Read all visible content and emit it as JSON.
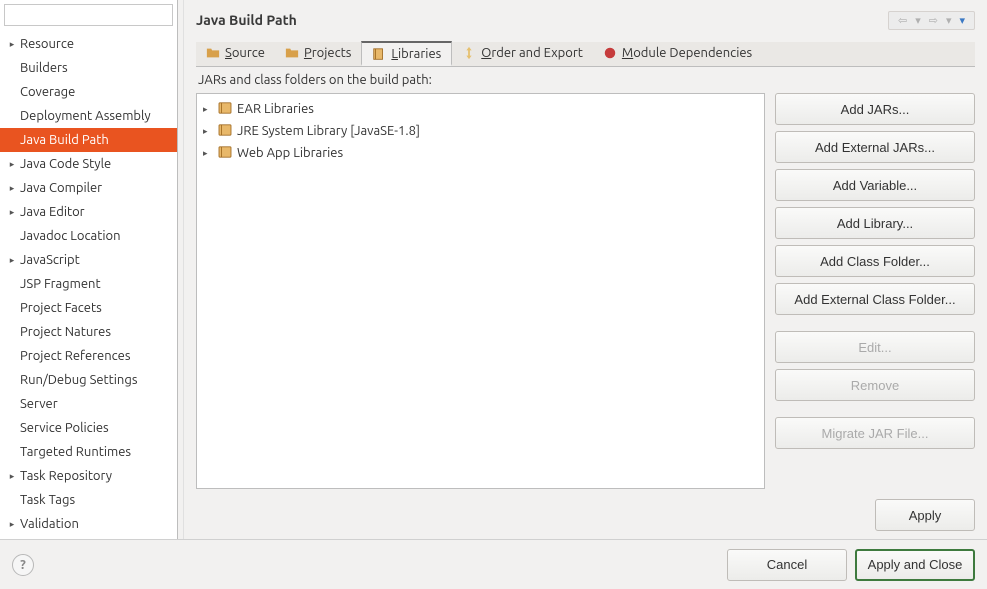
{
  "pageTitle": "Java Build Path",
  "filterPlaceholder": "",
  "sidebar": {
    "items": [
      {
        "label": "Resource",
        "expandable": true,
        "selected": false
      },
      {
        "label": "Builders",
        "expandable": false,
        "selected": false
      },
      {
        "label": "Coverage",
        "expandable": false,
        "selected": false
      },
      {
        "label": "Deployment Assembly",
        "expandable": false,
        "selected": false
      },
      {
        "label": "Java Build Path",
        "expandable": false,
        "selected": true
      },
      {
        "label": "Java Code Style",
        "expandable": true,
        "selected": false
      },
      {
        "label": "Java Compiler",
        "expandable": true,
        "selected": false
      },
      {
        "label": "Java Editor",
        "expandable": true,
        "selected": false
      },
      {
        "label": "Javadoc Location",
        "expandable": false,
        "selected": false
      },
      {
        "label": "JavaScript",
        "expandable": true,
        "selected": false
      },
      {
        "label": "JSP Fragment",
        "expandable": false,
        "selected": false
      },
      {
        "label": "Project Facets",
        "expandable": false,
        "selected": false
      },
      {
        "label": "Project Natures",
        "expandable": false,
        "selected": false
      },
      {
        "label": "Project References",
        "expandable": false,
        "selected": false
      },
      {
        "label": "Run/Debug Settings",
        "expandable": false,
        "selected": false
      },
      {
        "label": "Server",
        "expandable": false,
        "selected": false
      },
      {
        "label": "Service Policies",
        "expandable": false,
        "selected": false
      },
      {
        "label": "Targeted Runtimes",
        "expandable": false,
        "selected": false
      },
      {
        "label": "Task Repository",
        "expandable": true,
        "selected": false
      },
      {
        "label": "Task Tags",
        "expandable": false,
        "selected": false
      },
      {
        "label": "Validation",
        "expandable": true,
        "selected": false
      }
    ]
  },
  "tabs": [
    {
      "icon": "folder",
      "label": "Source",
      "mnemonic": "S"
    },
    {
      "icon": "folder",
      "label": "Projects",
      "mnemonic": "P"
    },
    {
      "icon": "book",
      "label": "Libraries",
      "mnemonic": "L",
      "active": true
    },
    {
      "icon": "arrows",
      "label": "Order and Export",
      "mnemonic": "O"
    },
    {
      "icon": "red",
      "label": "Module Dependencies",
      "mnemonic": "M"
    }
  ],
  "description": "JARs and class folders on the build path:",
  "libraries": [
    {
      "label": "EAR Libraries"
    },
    {
      "label": "JRE System Library [JavaSE-1.8]"
    },
    {
      "label": "Web App Libraries"
    }
  ],
  "buttons": {
    "addJars": "Add JARs...",
    "addExternalJars": "Add External JARs...",
    "addVariable": "Add Variable...",
    "addLibrary": "Add Library...",
    "addClassFolder": "Add Class Folder...",
    "addExternalClassFolder": "Add External Class Folder...",
    "edit": "Edit...",
    "remove": "Remove",
    "migrate": "Migrate JAR File...",
    "apply": "Apply",
    "cancel": "Cancel",
    "applyClose": "Apply and Close"
  }
}
